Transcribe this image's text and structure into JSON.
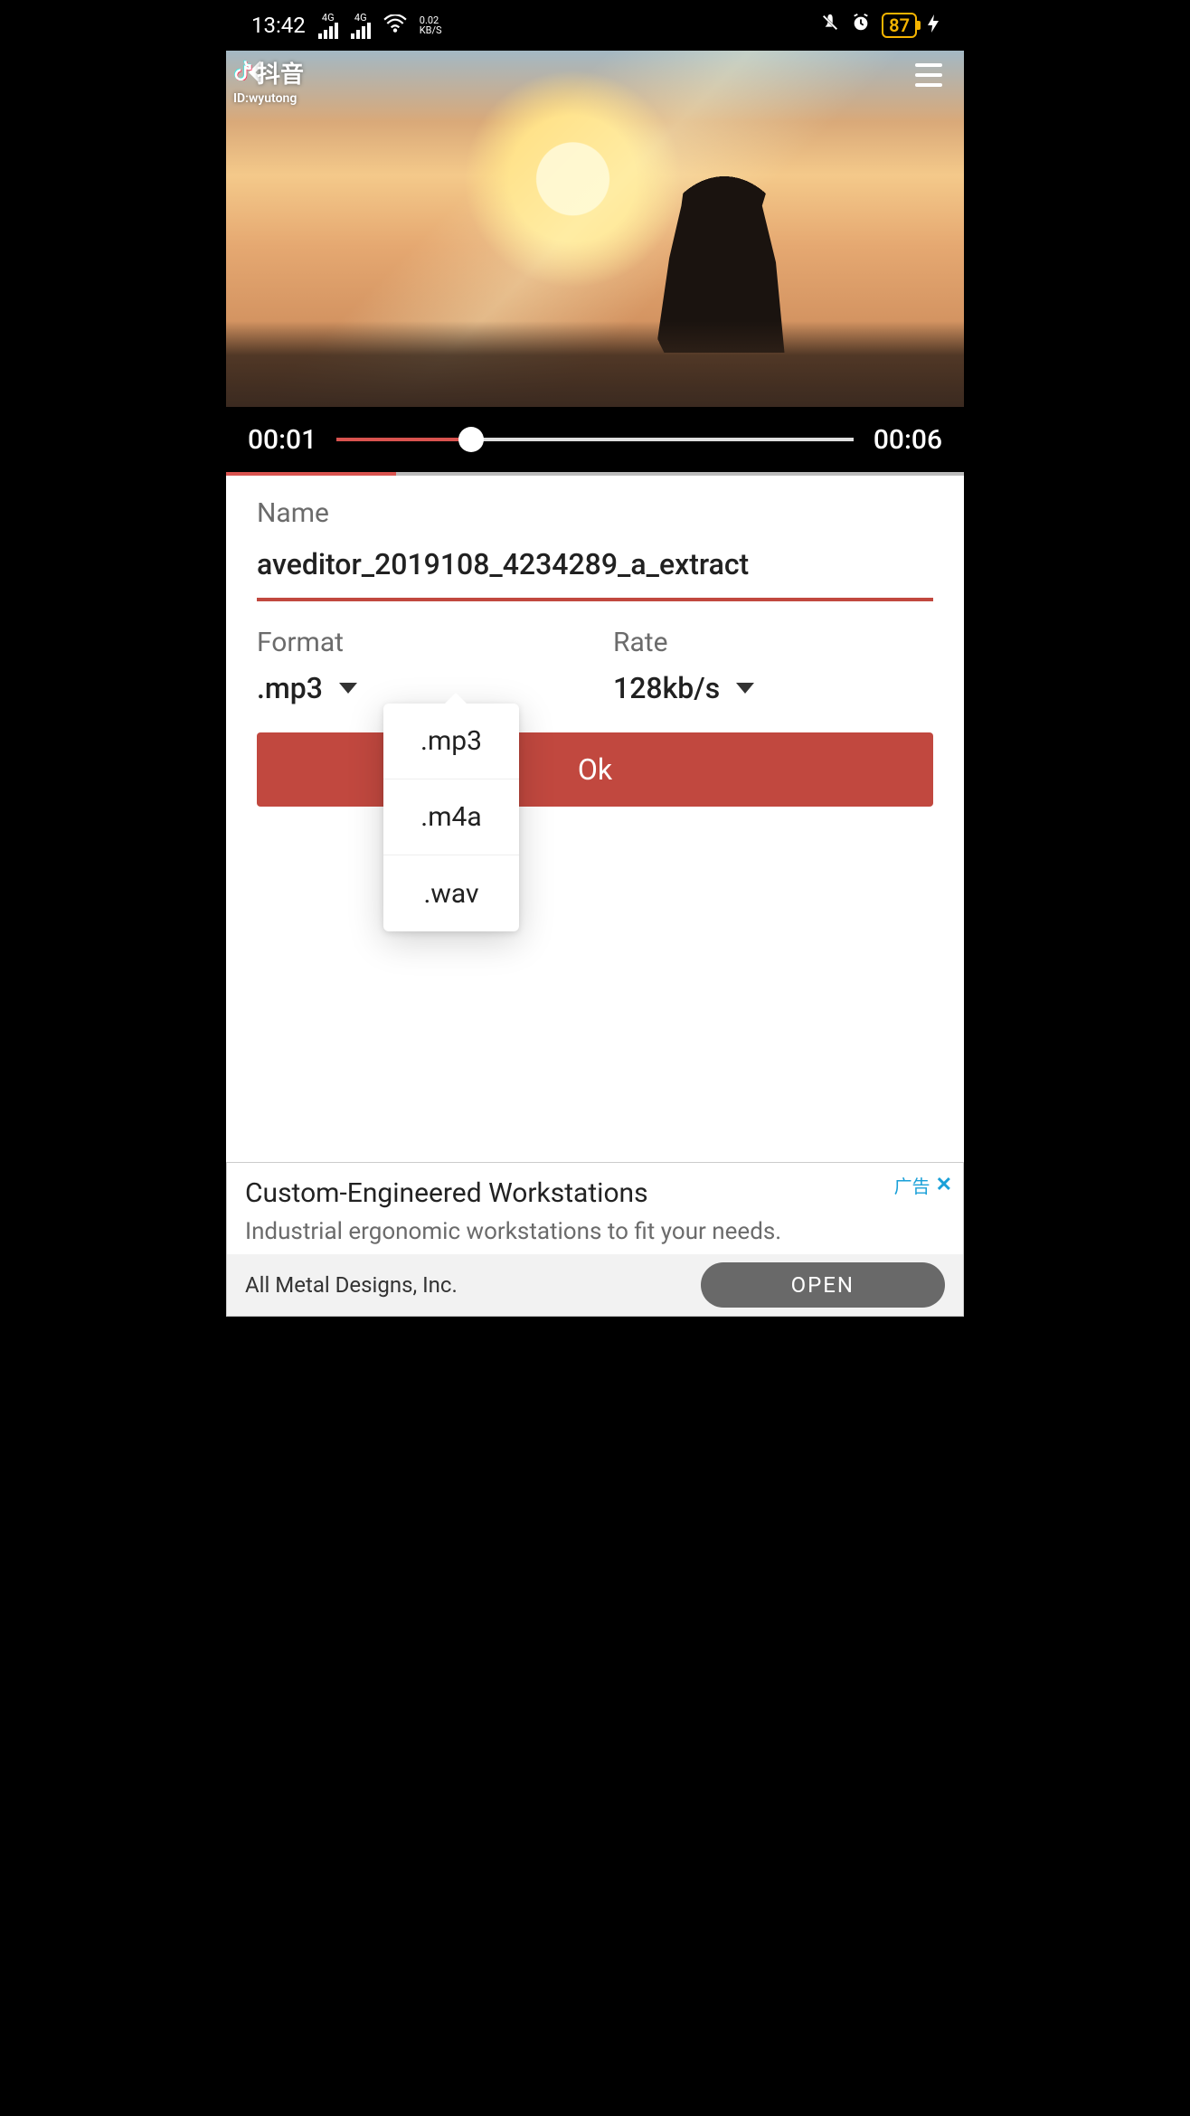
{
  "statusbar": {
    "time": "13:42",
    "net_label_top1": "4G",
    "net_label_top2": "4G",
    "kbps_top": "0.02",
    "kbps_bot": "KB/S",
    "battery_pct": "87"
  },
  "video": {
    "watermark_brand": "抖音",
    "watermark_id": "ID:wyutong",
    "current_time": "00:01",
    "duration": "00:06"
  },
  "form": {
    "name_label": "Name",
    "name_value": "aveditor_2019108_4234289_a_extract",
    "format_label": "Format",
    "format_value": ".mp3",
    "rate_label": "Rate",
    "rate_value": "128kb/s",
    "ok_label": "Ok"
  },
  "format_options": [
    ".mp3",
    ".m4a",
    ".wav"
  ],
  "ad": {
    "badge": "广告",
    "title": "Custom-Engineered Workstations",
    "subtitle": "Industrial ergonomic workstations to fit your needs.",
    "source": "All Metal Designs, Inc.",
    "cta": "OPEN"
  }
}
